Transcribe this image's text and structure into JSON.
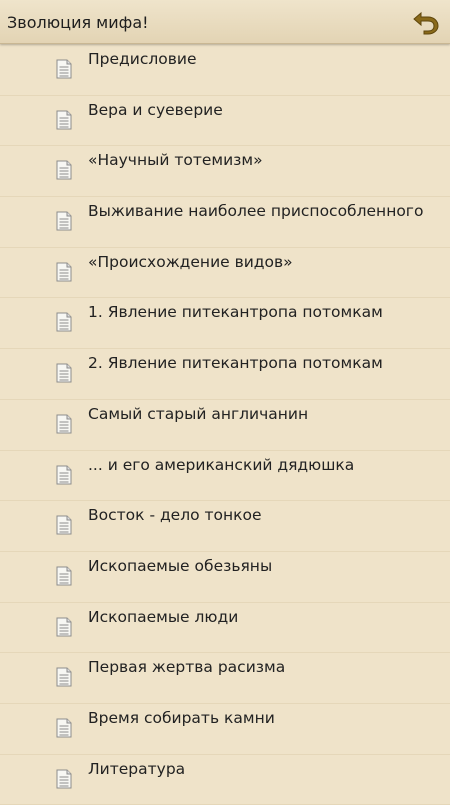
{
  "header": {
    "title": "Зволюция мифа!",
    "back_icon": "back-arrow-icon"
  },
  "colors": {
    "background": "#efe3c9",
    "accent": "#8a6a1a"
  },
  "items": [
    {
      "label": "Предисловие",
      "icon": "document-icon"
    },
    {
      "label": "Вера и суеверие",
      "icon": "document-icon"
    },
    {
      "label": "«Научный тотемизм»",
      "icon": "document-icon"
    },
    {
      "label": "Выживание наиболее приспособленного",
      "icon": "document-icon"
    },
    {
      "label": "«Происхождение видов»",
      "icon": "document-icon"
    },
    {
      "label": "1. Явление питекантропа потомкам",
      "icon": "document-icon"
    },
    {
      "label": "2. Явление питекантропа потомкам",
      "icon": "document-icon"
    },
    {
      "label": "Самый старый англичанин",
      "icon": "document-icon"
    },
    {
      "label": "... и его американский дядюшка",
      "icon": "document-icon"
    },
    {
      "label": "Восток - дело тонкое",
      "icon": "document-icon"
    },
    {
      "label": "Ископаемые обезьяны",
      "icon": "document-icon"
    },
    {
      "label": "Ископаемые люди",
      "icon": "document-icon"
    },
    {
      "label": "Первая жертва расизма",
      "icon": "document-icon"
    },
    {
      "label": "Время собирать камни",
      "icon": "document-icon"
    },
    {
      "label": "Литература",
      "icon": "document-icon"
    }
  ]
}
